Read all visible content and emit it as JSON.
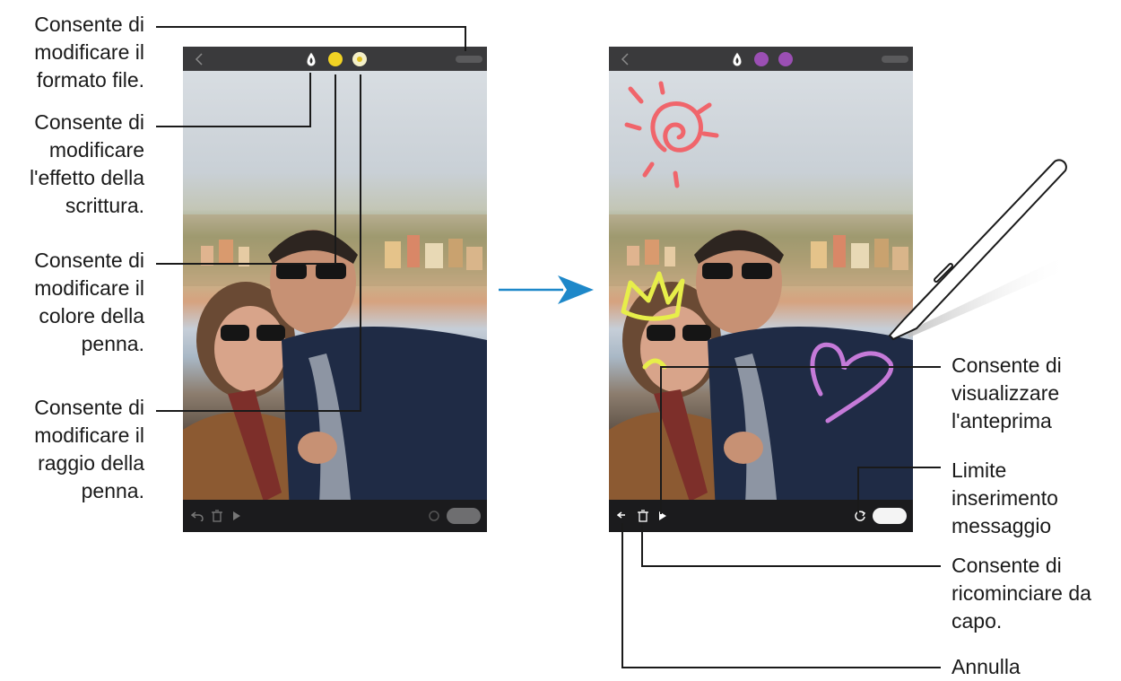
{
  "left_callouts": [
    {
      "lines": [
        "Consente di",
        "modificare il",
        "formato file."
      ]
    },
    {
      "lines": [
        "Consente di",
        "modificare",
        "l'effetto della",
        "scrittura."
      ]
    },
    {
      "lines": [
        "Consente di",
        "modificare il",
        "colore della",
        "penna."
      ]
    },
    {
      "lines": [
        "Consente di",
        "modificare il",
        "raggio della",
        "penna."
      ]
    }
  ],
  "right_callouts": [
    {
      "lines": [
        "Consente di",
        "visualizzare",
        "l'anteprima"
      ]
    },
    {
      "lines": [
        "Limite",
        "inserimento",
        "messaggio"
      ]
    },
    {
      "lines": [
        "Consente di",
        "ricominciare da",
        "capo."
      ]
    },
    {
      "lines": [
        "Annulla"
      ]
    }
  ],
  "colors": {
    "pen_color_left": "#f2d324",
    "pen_color_right": "#9b4fb4",
    "arrow": "#1e88c9",
    "sun_drawing": "#f0656b",
    "crown_drawing": "#e7ee4a",
    "heart_drawing": "#c57ad8"
  },
  "icons": {
    "effect": "pen-effect-icon",
    "undo": "undo-icon",
    "delete": "trash-icon",
    "preview": "play-icon",
    "limit": "refresh-icon",
    "back": "back-icon"
  }
}
